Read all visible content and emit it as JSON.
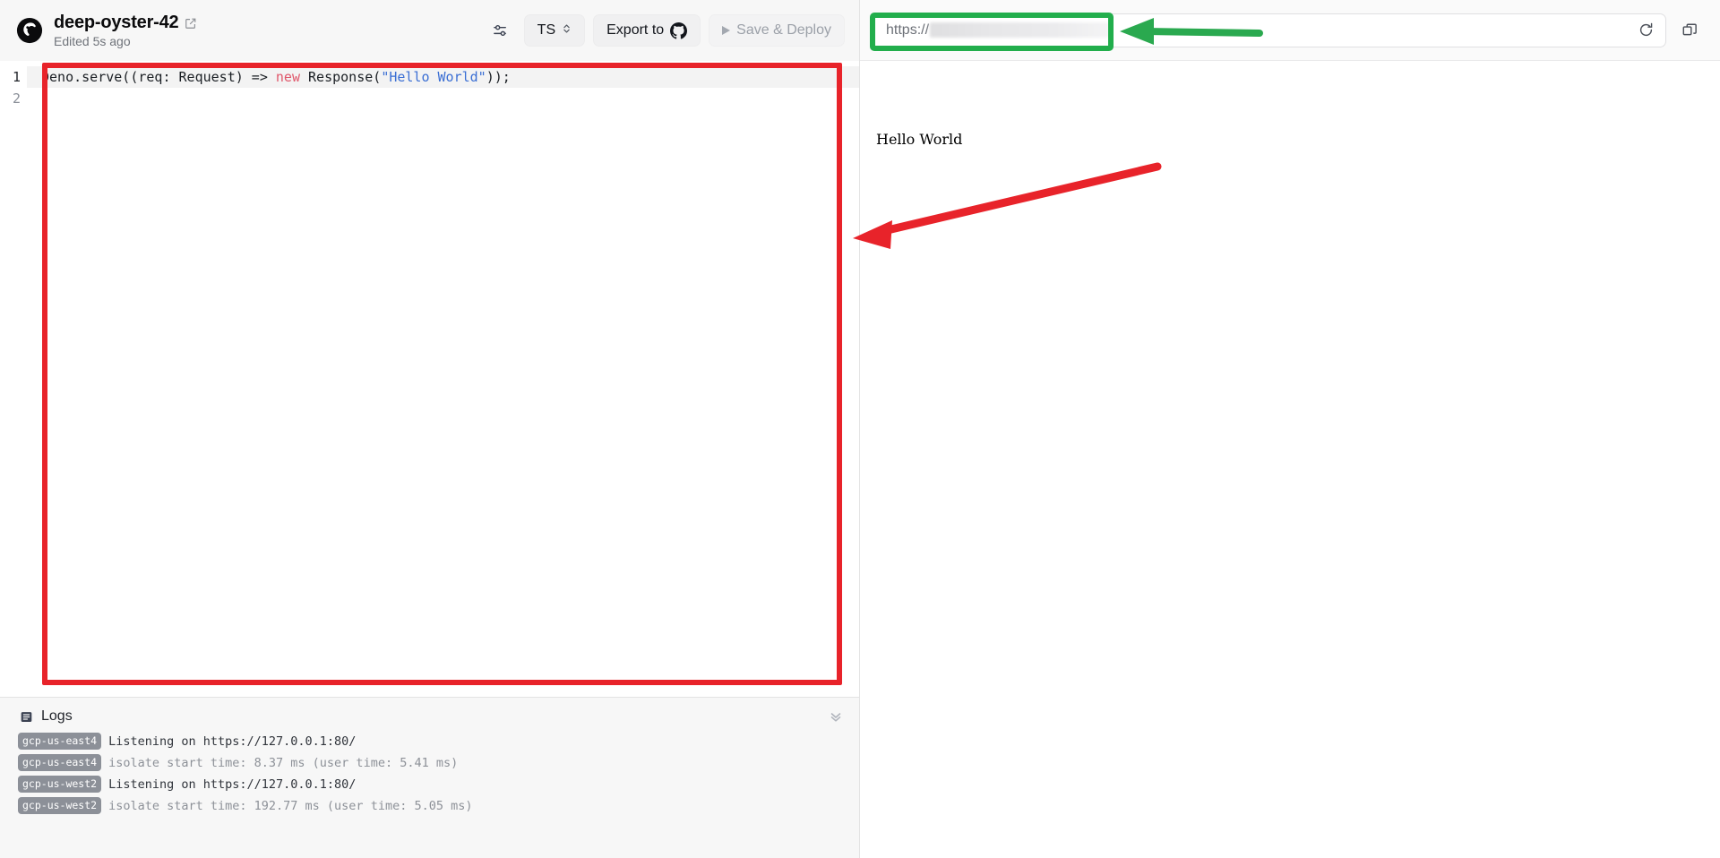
{
  "header": {
    "logo_icon": "deno-logo-icon",
    "project_title": "deep-oyster-42",
    "edit_title_icon": "pencil-square-icon",
    "edited_status": "Edited 5s ago",
    "actions": {
      "settings_icon": "sliders-settings-icon",
      "language_label": "TS",
      "language_chevron_icon": "chevron-up-down-icon",
      "export_label": "Export to",
      "export_icon": "github-icon",
      "deploy_label": "Save & Deploy",
      "deploy_play_icon": "play-triangle-icon"
    }
  },
  "editor": {
    "language": "TS",
    "line_numbers": [
      "1",
      "2"
    ],
    "lines": [
      {
        "number": "1",
        "tokens": [
          {
            "text": "Deno.serve((req: Request) => ",
            "kind": "plain"
          },
          {
            "text": "new",
            "kind": "keyword"
          },
          {
            "text": " Response(",
            "kind": "plain"
          },
          {
            "text": "\"Hello World\"",
            "kind": "string"
          },
          {
            "text": "));",
            "kind": "plain"
          }
        ],
        "plain": "Deno.serve((req: Request) => new Response(\"Hello World\"));"
      },
      {
        "number": "2",
        "tokens": [],
        "plain": ""
      }
    ]
  },
  "logs": {
    "icon": "logs-list-icon",
    "title": "Logs",
    "collapse_icon": "double-chevron-down-icon",
    "entries": [
      {
        "region": "gcp-us-east4",
        "message": "Listening on https://127.0.0.1:80/",
        "dim": false
      },
      {
        "region": "gcp-us-east4",
        "message": "isolate start time: 8.37 ms (user time: 5.41 ms)",
        "dim": true
      },
      {
        "region": "gcp-us-west2",
        "message": "Listening on https://127.0.0.1:80/",
        "dim": false
      },
      {
        "region": "gcp-us-west2",
        "message": "isolate start time: 192.77 ms (user time: 5.05 ms)",
        "dim": true
      }
    ]
  },
  "preview": {
    "url_bar": {
      "url_prefix": "https://",
      "url_redacted": true,
      "refresh_icon": "refresh-icon",
      "popout_icon": "open-in-new-window-icon"
    },
    "body_text": "Hello World"
  },
  "annotations": {
    "red_box": {
      "label": "code-editor-highlight",
      "color": "#e8232a"
    },
    "green_box": {
      "label": "url-field-highlight",
      "color": "#22ae4c"
    },
    "red_arrow": {
      "label": "arrow-to-editor",
      "color": "#e8232a"
    },
    "green_arrow": {
      "label": "arrow-to-url",
      "color": "#2aa94f"
    }
  },
  "colors": {
    "accent_red": "#e8232a",
    "accent_green": "#22ae4c",
    "keyword": "#e0576b",
    "string": "#3b6fd4",
    "panel_bg": "#f7f7f7"
  }
}
